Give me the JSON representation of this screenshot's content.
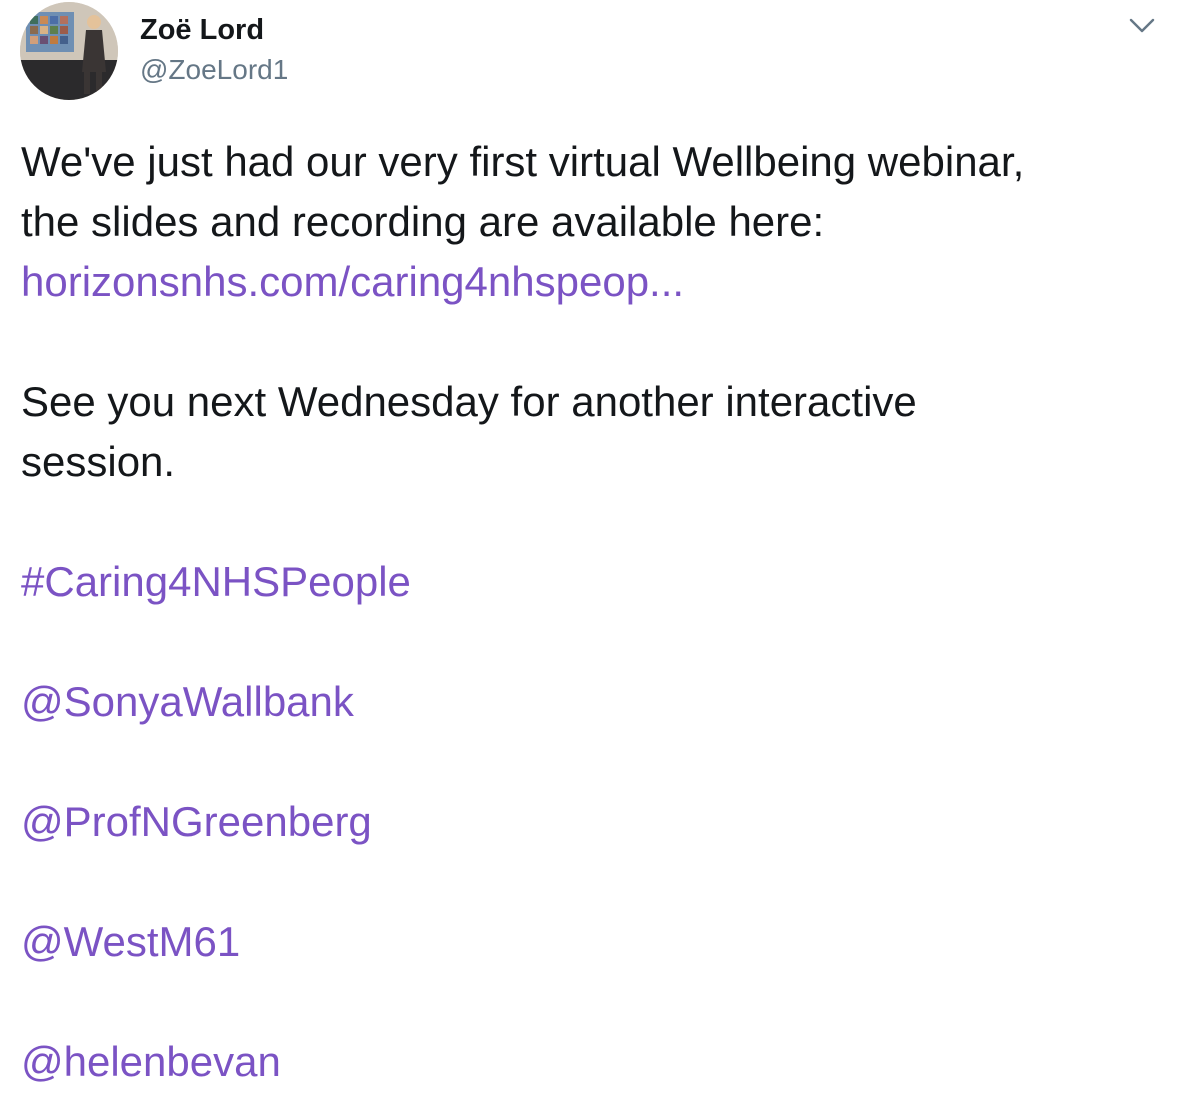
{
  "author": {
    "display_name": "Zoë Lord",
    "handle": "@ZoeLord1"
  },
  "menu": {
    "icon": "chevron-down-icon"
  },
  "tweet": {
    "line1": "We've just had our very first virtual Wellbeing webinar,",
    "line2": "the slides and recording are available here:",
    "link": "horizonsnhs.com/caring4nhspeop...",
    "line4": "See you next Wednesday for another interactive",
    "line5": "session.",
    "hashtag": "#Caring4NHSPeople",
    "mentions": [
      "@SonyaWallbank",
      "@ProfNGreenberg",
      "@WestM61",
      "@helenbevan"
    ]
  },
  "colors": {
    "link": "#7b53c4",
    "text": "#14171a",
    "secondary": "#657786"
  }
}
